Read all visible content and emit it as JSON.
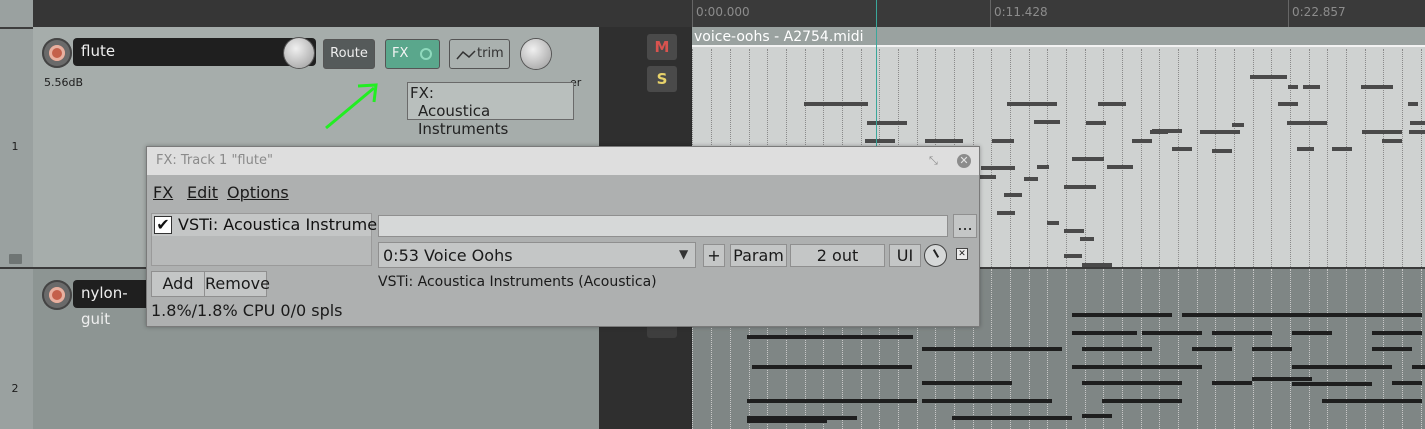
{
  "tracks": [
    {
      "number": "1",
      "name": "flute",
      "volume": "5.56dB"
    },
    {
      "number": "2",
      "name": "nylon-guit"
    }
  ],
  "track_controls": {
    "route_label": "Route",
    "fx_label": "FX",
    "trim_label": "trim",
    "partial_text": "er",
    "fx_tooltip_line1": "FX:",
    "fx_tooltip_line2": "Acoustica Instruments"
  },
  "mixer": {
    "mute_label": "M",
    "solo_label": "S"
  },
  "ruler": {
    "times": [
      "0:00.000",
      "0:11.428",
      "0:22.857"
    ]
  },
  "midi_item": {
    "title": "voice-oohs - A2754.midi"
  },
  "fx_window": {
    "title": "FX: Track 1 \"flute\"",
    "menu": {
      "fx": "FX",
      "edit": "Edit",
      "options": "Options"
    },
    "plugin_checked": true,
    "plugin_name": "VSTi: Acoustica Instrument",
    "add_label": "Add",
    "remove_label": "Remove",
    "cpu_status": "1.8%/1.8% CPU 0/0 spls",
    "preset_value": "",
    "browse_label": "...",
    "program": "0:53 Voice Oohs",
    "plus_label": "+",
    "param_label": "Param",
    "out_label": "2 out",
    "ui_label": "UI",
    "plugin_info": "VSTi: Acoustica Instruments (Acoustica)"
  },
  "colors": {
    "accent_green": "#5aa78c",
    "annotation_arrow": "#22ee22",
    "mute_red": "#d9534f",
    "solo_yellow": "#e8d36a",
    "cursor_teal": "#3aa79b"
  }
}
